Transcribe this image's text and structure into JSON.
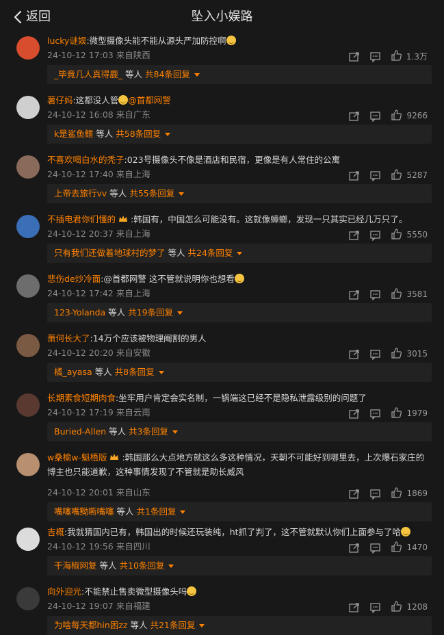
{
  "header": {
    "back_label": "返回",
    "title": "坠入小娱路"
  },
  "comments": [
    {
      "user": "lucky谜娱",
      "text": ":微型摄像头能不能从源头严加防控啊",
      "emoji": "sweat-face",
      "time": "24-10-12 17:03 来自陕西",
      "likes": "1.3万",
      "reply": {
        "name": "_毕竟几人真得鹿_",
        "mid": "等人",
        "count": "共84条回复"
      }
    },
    {
      "user": "薯仔妈",
      "text": ":这都没人管",
      "emoji": "blush-face",
      "tail": "@首都网警",
      "time": "24-10-12 16:08 来自广东",
      "likes": "9266",
      "reply": {
        "name": "k是鲨鱼鳍",
        "mid": "等人",
        "count": "共58条回复"
      }
    },
    {
      "user": "不喜欢喝白水的秃子",
      "text": ":023号摄像头不像是酒店和民宿，更像是有人常住的公寓",
      "time": "24-10-12 17:40 来自上海",
      "likes": "5287",
      "reply": {
        "name": "上帝去旅行vv",
        "mid": "等人",
        "count": "共55条回复"
      }
    },
    {
      "user": "不插电君你们懂的",
      "badge": "crown",
      "text": ":韩国有，中国怎么可能没有。这就像蟑螂，发现一只其实已经几万只了。",
      "time": "24-10-12 20:37 来自上海",
      "likes": "5550",
      "reply": {
        "name": "只有我们还做着地球村的梦了",
        "mid": "等人",
        "count": "共24条回复"
      }
    },
    {
      "user": "悲伤de炒冷面",
      "text": ":@首都网警 这不管就说明你也想看",
      "emoji": "smile-face",
      "time": "24-10-12 17:42 来自上海",
      "likes": "3581",
      "reply": {
        "name": "123-Yolanda",
        "mid": "等人",
        "count": "共19条回复"
      }
    },
    {
      "user": "萧何长大了",
      "text": ":14万个应该被物理阉割的男人",
      "time": "24-10-12 20:20 来自安徽",
      "likes": "3015",
      "reply": {
        "name": "橘_ayasa",
        "mid": "等人",
        "count": "共8条回复"
      }
    },
    {
      "user": "长期素食短期肉食",
      "text": ":坐牢用户肯定会实名制，一锅端这已经不是隐私泄露级别的问题了",
      "time": "24-10-12 17:19 来自云南",
      "likes": "1979",
      "reply": {
        "name": "Buried-Allen",
        "mid": "等人",
        "count": "共3条回复"
      }
    },
    {
      "user": "w桑榆w-魁梧版",
      "badge": "crown",
      "text": ":韩国那么大点地方就这么多这种情况，天朝不可能好到哪里去，上次爆石家庄的博主也只能道歉，这种事情发现了不管就是助长威风",
      "time": "24-10-12 20:01 来自山东",
      "likes": "1869",
      "reply": {
        "name": "嘴噻嘴黝嘶嘴噻",
        "mid": "等人",
        "count": "共1条回复"
      }
    },
    {
      "user": "吉概",
      "text": ":我就猜国内已有，韩国出的时候还玩装纯，ht抓了判了，这不管就默认你们上面参与了哈",
      "emoji": "smile-face",
      "time": "24-10-12 19:56 来自四川",
      "likes": "1470",
      "reply": {
        "name": "干海椒网复",
        "mid": "等人",
        "count": "共10条回复"
      }
    },
    {
      "user": "向外迎光",
      "text": ":不能禁止售卖微型摄像头吗",
      "emoji": "blush-face",
      "time": "24-10-12 19:07 来自福建",
      "likes": "1208",
      "reply": {
        "name": "为啥每天都hin困zz",
        "mid": "等人",
        "count": "共21条回复"
      }
    }
  ]
}
